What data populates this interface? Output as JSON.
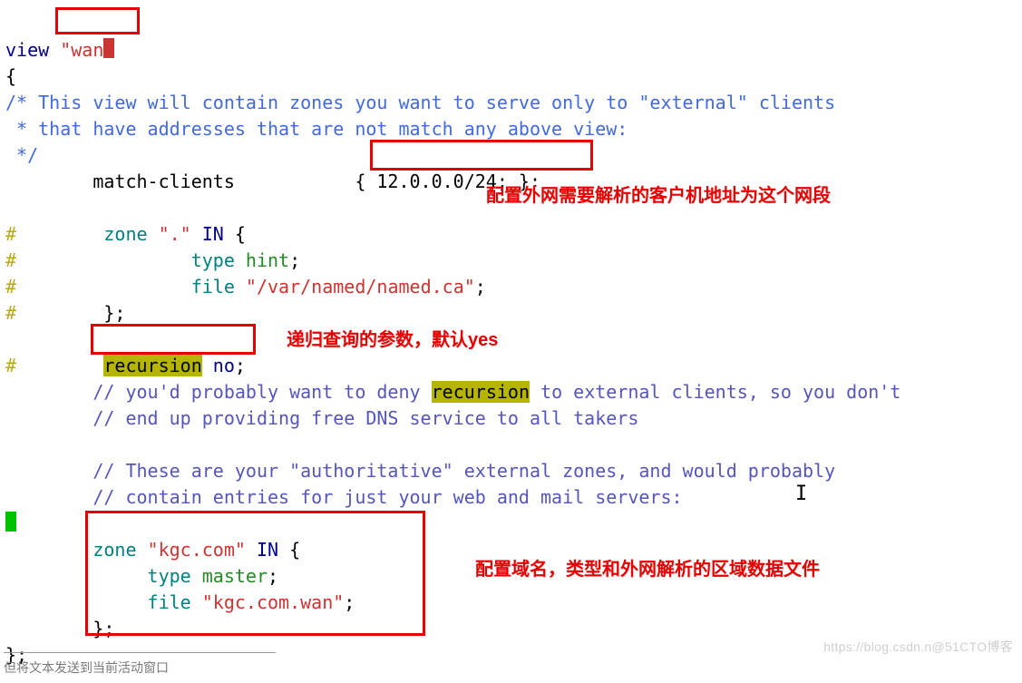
{
  "code": {
    "l1_view": "view ",
    "l1_q1": "\"",
    "l1_wan": "wan",
    "l2_brace": "{",
    "l3": "/* This view will contain zones you want to serve only to \"external\" clients",
    "l4": " * that have addresses that are not match any above view:",
    "l5": " */",
    "l6_label": "        match-clients           ",
    "l6_val": "{ 12.0.0.0/24; };",
    "hash": "#",
    "l8_zone": "        zone ",
    "l8_dot": "\".\"",
    "l8_in": " IN ",
    "l8_brace": "{",
    "l9_type": "                type ",
    "l9_hint": "hint",
    "l9_semi": ";",
    "l10_file": "                file ",
    "l10_path": "\"/var/named/named.ca\"",
    "l10_semi": ";",
    "l11_close": "        };",
    "l13_rec": "        ",
    "l13_recword": "recursion",
    "l13_no": " no",
    "l13_semi": ";",
    "c14a": "        // you'd probably want to deny ",
    "c14b": "recursion",
    "c14c": " to external clients, so you don't",
    "c15": "        // end up providing free DNS service to all takers",
    "c17": "        // These are your \"authoritative\" external zones, and would probably",
    "c18": "        // contain entries for just your web and mail servers:",
    "z1_zone": "        zone ",
    "z1_name": "\"kgc.com\"",
    "z1_in": " IN ",
    "z1_brace": "{",
    "z2_type": "             type ",
    "z2_master": "master",
    "z2_semi": ";",
    "z3_file": "             file ",
    "z3_name": "\"kgc.com.wan\"",
    "z3_semi": ";",
    "z4_close": "        };",
    "end": "};"
  },
  "annotations": {
    "a1": "配置外网需要解析的客户机地址为这个网段",
    "a2": "递归查询的参数，默认yes",
    "a3": "配置域名，类型和外网解析的区域数据文件"
  },
  "watermark": "https://blog.csdn.n@51CTO博客",
  "footer": "但将文本发送到当前活动窗口"
}
